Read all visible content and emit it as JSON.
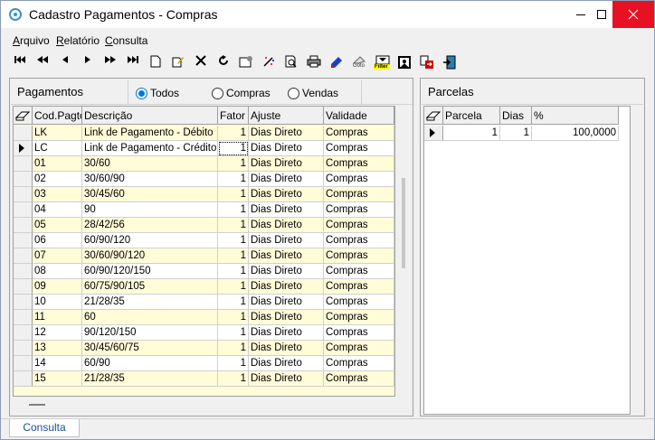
{
  "window": {
    "title": "Cadastro Pagamentos - Compras"
  },
  "menu": [
    {
      "label": "Arquivo",
      "accel": "A"
    },
    {
      "label": "Relatório",
      "accel": "R"
    },
    {
      "label": "Consulta",
      "accel": "C"
    }
  ],
  "toolbar": {
    "buttons": [
      "first-record-icon",
      "prior-page-icon",
      "prior-record-icon",
      "next-record-icon",
      "next-page-icon",
      "last-record-icon",
      "new-record-icon",
      "edit-record-icon",
      "delete-record-icon",
      "refresh-icon",
      "properties-icon",
      "magic-wand-icon",
      "preview-icon",
      "print-icon",
      "bookmark-icon",
      "goto-icon",
      "filter-icon",
      "image-icon",
      "export-icon",
      "exit-icon"
    ],
    "goto_label": "Goto",
    "filter_label": "Filter"
  },
  "left_panel": {
    "title": "Pagamentos",
    "radios": [
      {
        "label": "Todos",
        "checked": true
      },
      {
        "label": "Compras",
        "checked": false
      },
      {
        "label": "Vendas",
        "checked": false
      }
    ],
    "columns": [
      "Cod.Pagto",
      "Descrição",
      "Fator",
      "Ajuste",
      "Validade"
    ],
    "rows": [
      [
        "LK",
        "Link de Pagamento - Débito",
        "1",
        "Dias Direto",
        "Compras"
      ],
      [
        "LC",
        "Link de Pagamento - Crédito",
        "1",
        "Dias Direto",
        "Compras"
      ],
      [
        "01",
        "30/60",
        "1",
        "Dias Direto",
        "Compras"
      ],
      [
        "02",
        "30/60/90",
        "1",
        "Dias Direto",
        "Compras"
      ],
      [
        "03",
        "30/45/60",
        "1",
        "Dias Direto",
        "Compras"
      ],
      [
        "04",
        "90",
        "1",
        "Dias Direto",
        "Compras"
      ],
      [
        "05",
        "28/42/56",
        "1",
        "Dias Direto",
        "Compras"
      ],
      [
        "06",
        "60/90/120",
        "1",
        "Dias Direto",
        "Compras"
      ],
      [
        "07",
        "30/60/90/120",
        "1",
        "Dias Direto",
        "Compras"
      ],
      [
        "08",
        "60/90/120/150",
        "1",
        "Dias Direto",
        "Compras"
      ],
      [
        "09",
        "60/75/90/105",
        "1",
        "Dias Direto",
        "Compras"
      ],
      [
        "10",
        "21/28/35",
        "1",
        "Dias Direto",
        "Compras"
      ],
      [
        "11",
        "60",
        "1",
        "Dias Direto",
        "Compras"
      ],
      [
        "12",
        "90/120/150",
        "1",
        "Dias Direto",
        "Compras"
      ],
      [
        "13",
        "30/45/60/75",
        "1",
        "Dias Direto",
        "Compras"
      ],
      [
        "14",
        "60/90",
        "1",
        "Dias Direto",
        "Compras"
      ],
      [
        "15",
        "21/28/35",
        "1",
        "Dias Direto",
        "Compras"
      ]
    ],
    "selected_row": 1
  },
  "right_panel": {
    "title": "Parcelas",
    "columns": [
      "Parcela",
      "Dias",
      "%"
    ],
    "rows": [
      [
        "1",
        "1",
        "100,0000"
      ]
    ]
  },
  "status": {
    "tab": "Consulta"
  },
  "colors": {
    "row_alt": "#fffcd8",
    "accent": "#0078d7",
    "close": "#e81123"
  }
}
